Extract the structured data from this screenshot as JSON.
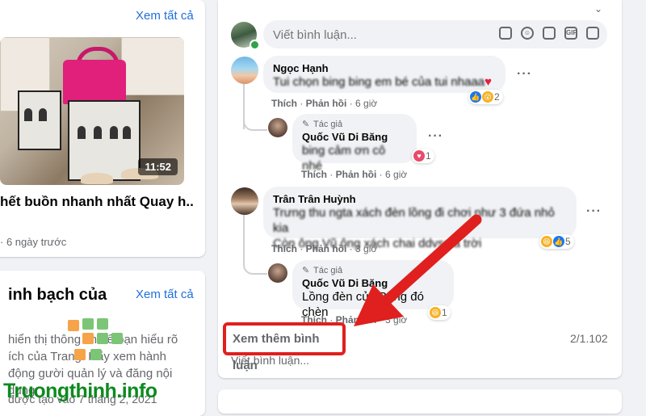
{
  "left": {
    "see_all_1": "Xem tất cả",
    "video_duration": "11:52",
    "video_title": "hết buồn nhanh nhất Quay h...",
    "video_time": "· 6 ngày trước",
    "section_title": "inh bạch của",
    "see_all_2": "Xem tất cả",
    "section_text": "hiển thị thông tin để bạn hiểu rõ ích của Trang. Hãy xem hành động gười quản lý và đăng nội dung.",
    "section_date": "được tạo vào 7 tháng 2, 2021"
  },
  "watermark": "Truongthinh.info",
  "comment_box": {
    "placeholder": "Viết bình luận..."
  },
  "comments": [
    {
      "name": "Ngọc Hạnh",
      "text": "Tui chọn bing bing em bé của tui nhaaa",
      "actions": {
        "like": "Thích",
        "reply": "Phản hồi",
        "time": "6 giờ"
      },
      "reaction_count": "2"
    },
    {
      "badge": "Tác giả",
      "name": "Quốc Vũ Di Băng",
      "text": "bing cảm ơn cô nhé",
      "actions": {
        "like": "Thích",
        "reply": "Phản hồi",
        "time": "6 giờ"
      },
      "reaction_count": "1"
    },
    {
      "name": "Trân Trân Huỳnh",
      "text_line1": "Trưng thu ngta xách đèn lồng đi chơi như 3 đứa nhỏ kia",
      "text_line2": "Còn ông Vũ ông xách chai ddvss á trời",
      "actions": {
        "like": "Thích",
        "reply": "Phản hồi",
        "time": "3 giờ"
      },
      "reaction_count": "5"
    },
    {
      "badge": "Tác giả",
      "name": "Quốc Vũ Di Băng",
      "text": "Lồng đèn của Băng đó chèn",
      "actions": {
        "like": "Thích",
        "reply": "Phản hồi",
        "time": "3 giờ"
      },
      "reaction_count": "1"
    }
  ],
  "more_comments": "Xem thêm bình luận",
  "comment_count": "2/1.102",
  "write_comment_footer": "Viết bình luận...",
  "colors": {
    "link": "#216fdb",
    "highlight": "#e0201e",
    "watermark": "#0d8a1f"
  }
}
